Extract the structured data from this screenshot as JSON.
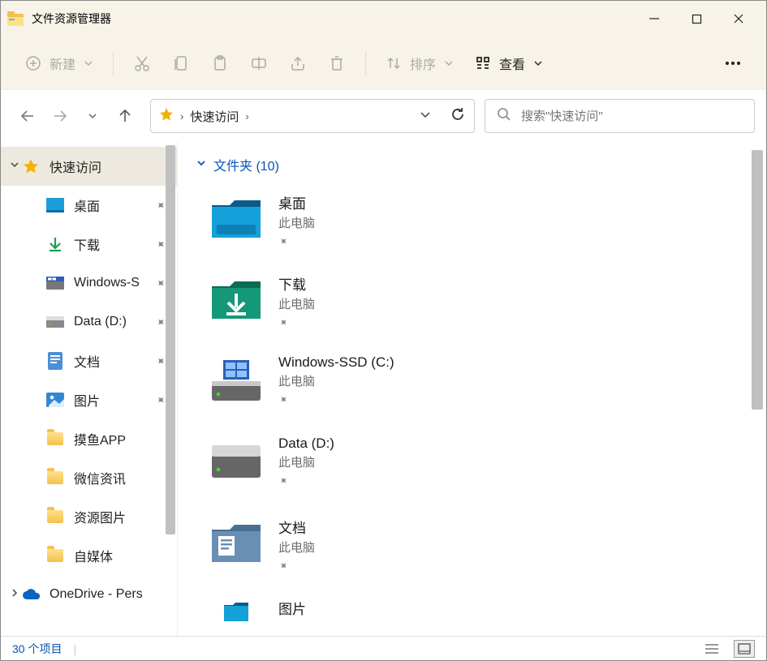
{
  "title": "文件资源管理器",
  "toolbar": {
    "new_label": "新建",
    "sort_label": "排序",
    "view_label": "查看"
  },
  "breadcrumb": {
    "label": "快速访问"
  },
  "search": {
    "placeholder": "搜索\"快速访问\""
  },
  "sidebar": {
    "items": [
      {
        "label": "快速访问"
      },
      {
        "label": "桌面"
      },
      {
        "label": "下载"
      },
      {
        "label": "Windows-S"
      },
      {
        "label": "Data (D:)"
      },
      {
        "label": "文档"
      },
      {
        "label": "图片"
      },
      {
        "label": "摸鱼APP"
      },
      {
        "label": "微信资讯"
      },
      {
        "label": "资源图片"
      },
      {
        "label": "自媒体"
      },
      {
        "label": "OneDrive - Pers"
      }
    ]
  },
  "section": {
    "header": "文件夹 (10)"
  },
  "files": [
    {
      "name": "桌面",
      "loc": "此电脑"
    },
    {
      "name": "下载",
      "loc": "此电脑"
    },
    {
      "name": "Windows-SSD (C:)",
      "loc": "此电脑"
    },
    {
      "name": "Data (D:)",
      "loc": "此电脑"
    },
    {
      "name": "文档",
      "loc": "此电脑"
    },
    {
      "name": "图片",
      "loc": ""
    }
  ],
  "status": {
    "count": "30 个项目"
  }
}
